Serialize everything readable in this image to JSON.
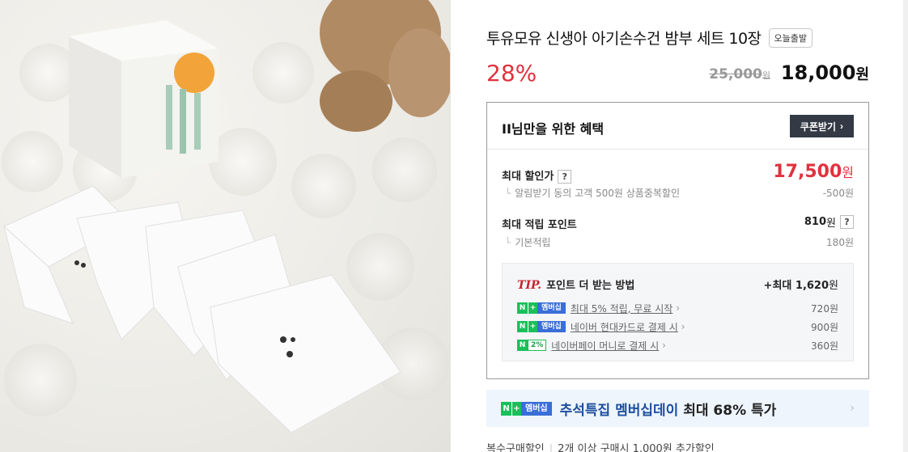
{
  "product": {
    "title": "투유모유 신생아 아기손수건 밤부 세트 10장",
    "ship_badge": "오늘출발",
    "discount": "28%",
    "original_price": "25,000",
    "original_unit": "원",
    "final_price": "18,000",
    "final_unit": "원"
  },
  "benefit": {
    "title": "II님만을 위한 혜택",
    "coupon_button": "쿠폰받기",
    "max_discount_label": "최대 할인가",
    "max_discount_price": "17,500",
    "max_discount_unit": "원",
    "alarm_sub": "알림받기 동의 고객 500원 상품중복할인",
    "alarm_sub_value": "-500원",
    "max_point_label": "최대 적립 포인트",
    "max_point_value": "810",
    "max_point_unit": "원",
    "basic_point_label": "기본적립",
    "basic_point_value": "180원",
    "help_mark": "?",
    "tip": {
      "tag": "TIP.",
      "title": "포인트 더 받는 방법",
      "max_prefix": "+최대",
      "max_value": "1,620",
      "max_unit": "원",
      "lines": [
        {
          "badge": "membership",
          "text": "최대 5% 적립, 무료 시작",
          "amount": "720원"
        },
        {
          "badge": "membership",
          "text": "네이버 현대카드로 결제 시",
          "amount": "900원"
        },
        {
          "badge": "pay2",
          "text": "네이버페이 머니로 결제 시",
          "amount": "360원"
        }
      ]
    }
  },
  "badges": {
    "n": "N",
    "plus": "+",
    "membership": "멤버십",
    "pct": "2%"
  },
  "promo": {
    "highlight": "추석특집 멤버십데이",
    "rest": "최대 68% 특가"
  },
  "bulk": {
    "label": "복수구매할인",
    "text": "2개 이상 구매시 1,000원 추가할인"
  },
  "colors": {
    "discount_red": "#e0323e",
    "naver_green": "#19c05a",
    "membership_blue": "#3a6ed8",
    "promo_bg": "#eef5fd"
  }
}
